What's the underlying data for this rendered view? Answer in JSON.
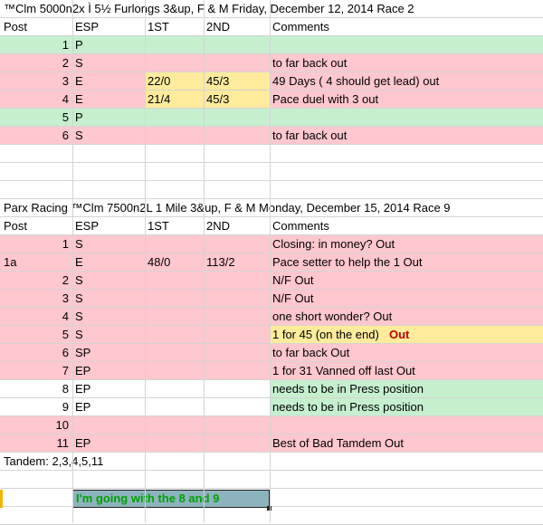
{
  "race1": {
    "title": "™Clm 5000n2x Ì 5½ Furlongs 3&up, F & M Friday, December 12, 2014 Race 2",
    "headers": {
      "post": "Post",
      "esp": "ESP",
      "first": "1ST",
      "second": "2ND",
      "comments": "Comments"
    },
    "rows": [
      {
        "post": "1",
        "esp": "P",
        "first": "",
        "second": "",
        "comment": "",
        "fill": "green"
      },
      {
        "post": "2",
        "esp": "S",
        "first": "",
        "second": "",
        "comment": "to far back out",
        "fill": "pink"
      },
      {
        "post": "3",
        "esp": "E",
        "first": "22/0",
        "second": "45/3",
        "comment": "49 Days ( 4 should get lead) out",
        "fill": "pink"
      },
      {
        "post": "4",
        "esp": "E",
        "first": "21/4",
        "second": "45/3",
        "comment": "Pace duel with 3 out",
        "fill": "pink"
      },
      {
        "post": "5",
        "esp": "P",
        "first": "",
        "second": "",
        "comment": "",
        "fill": "green"
      },
      {
        "post": "6",
        "esp": "S",
        "first": "",
        "second": "",
        "comment": "to far back out",
        "fill": "pink"
      }
    ]
  },
  "race2": {
    "title": "Parx Racing ™Clm 7500n2L 1 Mile 3&up, F & M Monday, December 15, 2014 Race 9",
    "headers": {
      "post": "Post",
      "esp": "ESP",
      "first": "1ST",
      "second": "2ND",
      "comments": "Comments"
    },
    "rows": [
      {
        "col_a": "",
        "post": "1",
        "esp": "S",
        "first": "",
        "second": "",
        "comment": "Closing: in money?  Out",
        "fill": "pink"
      },
      {
        "col_a": "1a",
        "post": "",
        "esp": "E",
        "first": "48/0",
        "second": "113/2",
        "comment": "Pace setter to help the 1  Out",
        "fill": "pink"
      },
      {
        "col_a": "",
        "post": "2",
        "esp": "S",
        "first": "",
        "second": "",
        "comment": "N/F    Out",
        "fill": "pink"
      },
      {
        "col_a": "",
        "post": "3",
        "esp": "S",
        "first": "",
        "second": "",
        "comment": "N/F    Out",
        "fill": "pink"
      },
      {
        "col_a": "",
        "post": "4",
        "esp": "S",
        "first": "",
        "second": "",
        "comment": "one short wonder?  Out",
        "fill": "pink"
      },
      {
        "col_a": "",
        "post": "5",
        "esp": "S",
        "first": "",
        "second": "",
        "comment": "1 for 45 (on the end)",
        "comment_bold": "Out",
        "fill": "pink",
        "comment_fill": "yellow"
      },
      {
        "col_a": "",
        "post": "6",
        "esp": "SP",
        "first": "",
        "second": "",
        "comment": "to far back Out",
        "fill": "pink"
      },
      {
        "col_a": "",
        "post": "7",
        "esp": "EP",
        "first": "",
        "second": "",
        "comment": "1 for 31 Vanned off last  Out",
        "fill": "pink"
      },
      {
        "col_a": "",
        "post": "8",
        "esp": "EP",
        "first": "",
        "second": "",
        "comment": "needs to be in Press position",
        "fill": "none",
        "comment_fill": "green"
      },
      {
        "col_a": "",
        "post": "9",
        "esp": "EP",
        "first": "",
        "second": "",
        "comment": "needs to be in Press position",
        "fill": "none",
        "comment_fill": "green"
      },
      {
        "col_a": "",
        "post": "10",
        "esp": "",
        "first": "",
        "second": "",
        "comment": "",
        "fill": "pink"
      },
      {
        "col_a": "",
        "post": "11",
        "esp": "EP",
        "first": "",
        "second": "",
        "comment": "Best of Bad Tamdem  Out",
        "fill": "pink"
      }
    ]
  },
  "tandem": "Tandem: 2,3,4,5,11",
  "callout": "I'm going with the 8 and 9",
  "colors": {
    "pink": "#ffc7ce",
    "green": "#c6efce",
    "yellow": "#ffeb9c",
    "callout_bg": "#8db3bf",
    "callout_text": "#00a000",
    "out_red": "#c00000"
  }
}
